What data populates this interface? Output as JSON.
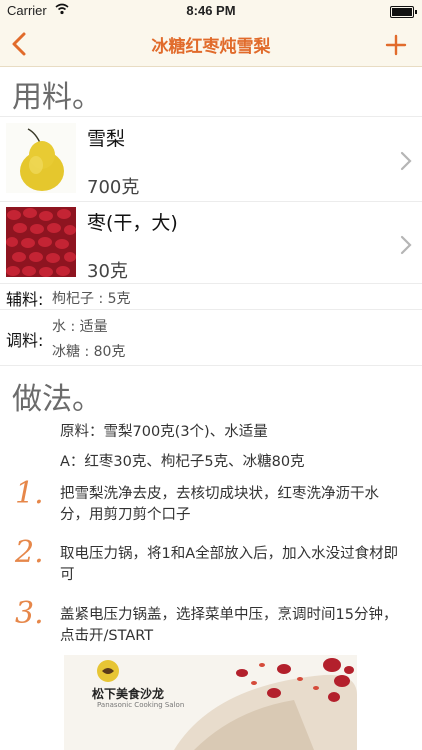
{
  "status": {
    "carrier": "Carrier",
    "time": "8:46 PM"
  },
  "nav": {
    "title": "冰糖红枣炖雪梨"
  },
  "sections": {
    "ingredients": "用料。",
    "method": "做法。"
  },
  "ingredients": [
    {
      "name": "雪梨",
      "qty": "700克",
      "icon": "pear-image"
    },
    {
      "name": "枣(干，大)",
      "qty": "30克",
      "icon": "dried-jujube-image"
    }
  ],
  "aux": {
    "label": "辅料:",
    "value": "枸杞子 : 5克"
  },
  "seasoning": {
    "label": "调料:",
    "values": [
      "水 : 适量",
      "冰糖 : 80克"
    ]
  },
  "method": {
    "materials": "原料：雪梨700克(3个)、水适量",
    "mix_a": "A：红枣30克、枸杞子5克、冰糖80克",
    "steps": [
      {
        "num": "1.",
        "text": "把雪梨洗净去皮，去核切成块状，红枣洗净沥干水分，用剪刀剪个口子"
      },
      {
        "num": "2.",
        "text": "取电压力锅，将1和A全部放入后，加入水没过食材即可"
      },
      {
        "num": "3.",
        "text": "盖紧电压力锅盖，选择菜单中压，烹调时间15分钟，点击开/START"
      }
    ]
  },
  "photo": {
    "logo_text": "松下美食沙龙",
    "logo_sub": "Panasonic Cooking Salon"
  },
  "colors": {
    "accent": "#e16b2b",
    "navbar_bg": "#fbf7ec",
    "step_number": "#e6874a"
  }
}
